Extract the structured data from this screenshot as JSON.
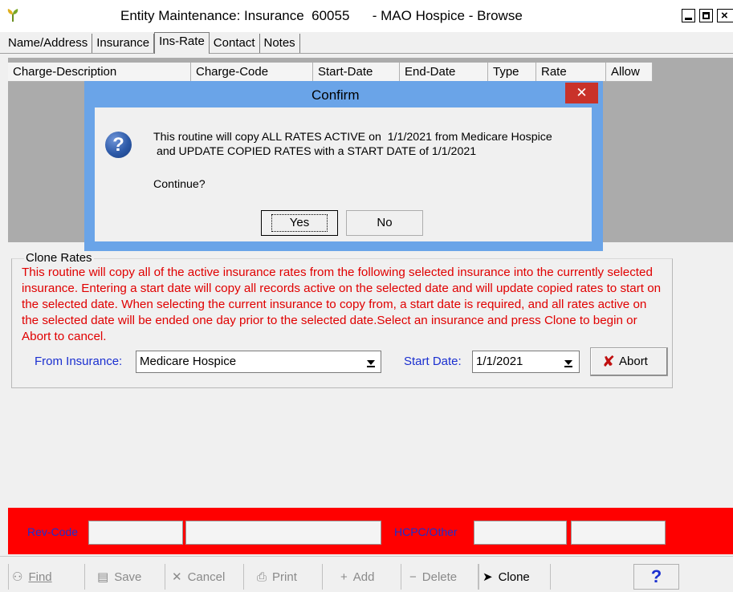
{
  "window": {
    "title": "Entity Maintenance: Insurance  60055      - MAO Hospice - Browse",
    "icon": "app-plant-icon"
  },
  "tabs": [
    {
      "label": "Name/Address"
    },
    {
      "label": "Insurance"
    },
    {
      "label": "Ins-Rate",
      "active": true
    },
    {
      "label": "Contact"
    },
    {
      "label": "Notes"
    }
  ],
  "grid": {
    "columns": [
      "Charge-Description",
      "Charge-Code",
      "Start-Date",
      "End-Date",
      "Type",
      "Rate",
      "Allow"
    ]
  },
  "clone": {
    "legend": "Clone Rates",
    "instructions": "This routine will copy all of the active insurance rates from the following selected insurance into the currently selected insurance. Entering a start date will copy all records active on the selected date and will update copied rates to start on the selected date. When selecting the current insurance to copy from, a start date is required, and all rates active on the selected date will be ended one day prior to the selected date.Select an insurance and press Clone to begin or Abort to cancel.",
    "from_label": "From Insurance:",
    "from_value": "Medicare Hospice",
    "date_label": "Start Date:",
    "date_value": "1/1/2021",
    "abort_label": "Abort"
  },
  "detail": {
    "rev_code_label": "Rev-Code",
    "hcpc_label": "HCPC/Other"
  },
  "toolbar": {
    "find": "Find",
    "save": "Save",
    "cancel": "Cancel",
    "print": "Print",
    "add": "Add",
    "delete": "Delete",
    "clone": "Clone",
    "help": "?"
  },
  "dialog": {
    "title": "Confirm",
    "close": "✕",
    "line1": "This routine will copy ALL RATES ACTIVE on  1/1/2021 from Medicare Hospice",
    "line2": " and UPDATE COPIED RATES with a START DATE of 1/1/2021",
    "prompt": "Continue?",
    "yes": "Yes",
    "no": "No"
  },
  "colors": {
    "accent_blue": "#1a2fd0",
    "warning_red": "#e00000",
    "detail_bar": "#ff0000",
    "dialog_frame": "#6aa4e8"
  }
}
